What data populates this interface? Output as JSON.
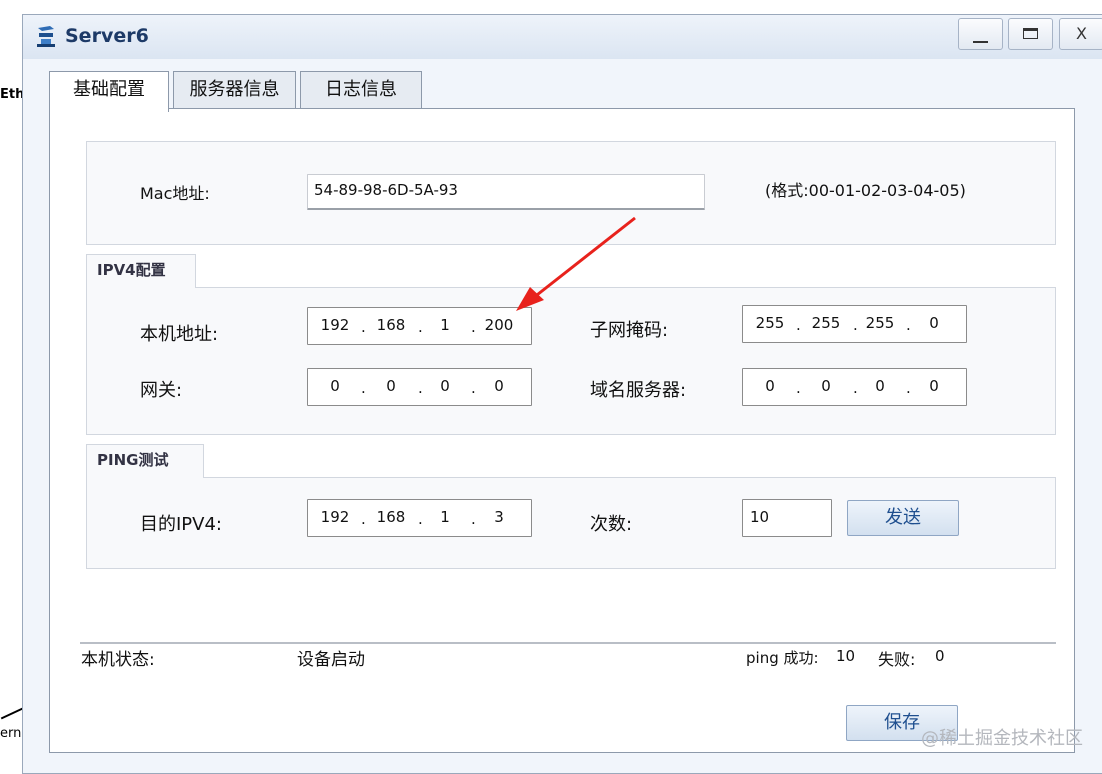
{
  "background": {
    "left_fragment_top": "Eth",
    "left_fragment_bottom": "ern"
  },
  "window": {
    "title": "Server6",
    "minimize_symbol": "",
    "maximize_symbol": "",
    "close_symbol": "X"
  },
  "tabs": [
    {
      "label": "基础配置",
      "active": true
    },
    {
      "label": "服务器信息",
      "active": false
    },
    {
      "label": "日志信息",
      "active": false
    }
  ],
  "mac": {
    "label": "Mac地址:",
    "value": "54-89-98-6D-5A-93",
    "format_hint": "(格式:00-01-02-03-04-05)"
  },
  "ipv4": {
    "title": "IPV4配置",
    "host_label": "本机地址:",
    "host": [
      "192",
      "168",
      "1",
      "200"
    ],
    "mask_label": "子网掩码:",
    "mask": [
      "255",
      "255",
      "255",
      "0"
    ],
    "gateway_label": "网关:",
    "gateway": [
      "0",
      "0",
      "0",
      "0"
    ],
    "dns_label": "域名服务器:",
    "dns": [
      "0",
      "0",
      "0",
      "0"
    ]
  },
  "ping": {
    "title": "PING测试",
    "dest_label": "目的IPV4:",
    "dest": [
      "192",
      "168",
      "1",
      "3"
    ],
    "count_label": "次数:",
    "count": "10",
    "send_label": "发送"
  },
  "status": {
    "label": "本机状态:",
    "value": "设备启动",
    "success_label": "ping 成功:",
    "success": "10",
    "fail_label": "失败:",
    "fail": "0"
  },
  "save_label": "保存",
  "watermark": "@稀土掘金技术社区",
  "colors": {
    "title_text": "#1d3a67",
    "button_text": "#1f4f8f",
    "arrow": "#e8221c"
  }
}
